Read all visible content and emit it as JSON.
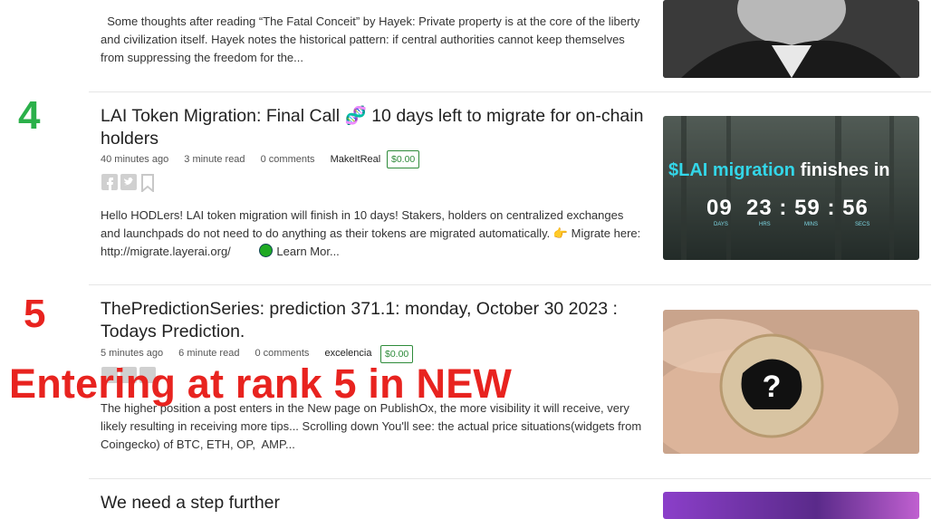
{
  "posts": [
    {
      "excerpt": "  Some thoughts after reading “The Fatal Conceit” by Hayek: Private property is at the core of the liberty and civilization itself. Hayek notes the historical pattern: if central authorities cannot keep themselves from suppressing the freedom for the..."
    },
    {
      "rank": "4",
      "title": "LAI Token Migration: Final Call 🧬 10 days left to migrate for on-chain holders",
      "time": "40 minutes ago",
      "read": "3 minute read",
      "comments": "0 comments",
      "author": "MakeItReal",
      "tips": "$0.00",
      "excerpt_main": "Hello HODLers! LAI token migration will finish in 10 days! Stakers, holders on centralized exchanges and launchpads do not need to do anything as their tokens are migrated automatically. 👉 Migrate here: http://migrate.layerai.org/",
      "learn_more": "Learn Mor...",
      "thumb": {
        "ticker": "$LAI migration",
        "suffix": "finishes in",
        "days": "09",
        "hrs": "23",
        "mins": "59",
        "secs": "56",
        "days_label": "DAYS",
        "hrs_label": "HRS",
        "mins_label": "MINS",
        "secs_label": "SECS"
      }
    },
    {
      "rank": "5",
      "title": "ThePredictionSeries: prediction 371.1: monday, October 30 2023 : Todays Prediction.",
      "time": "5 minutes ago",
      "read": "6 minute read",
      "comments": "0 comments",
      "author": "excelencia",
      "tips": "$0.00",
      "excerpt": "The higher position a post enters in the New page on PublishOx, the more visibility it will receive, very likely resulting in receiving more tips... Scrolling down You'll see: the actual price situations(widgets from Coingecko) of BTC, ETH, OP,  AMP...",
      "thumb": {
        "symbol": "?"
      }
    },
    {
      "title": "We need a step further"
    }
  ],
  "overlay": "Entering at rank 5 in NEW",
  "colors": {
    "rank4": "#2bb04a",
    "rank5": "#e8231f",
    "overlay": "#e8231f",
    "tip_green": "#2e8b3a"
  },
  "icons": [
    "facebook-icon",
    "twitter-icon",
    "bookmark-icon",
    "point-right-emoji",
    "green-circle-emoji",
    "dna-emoji"
  ]
}
